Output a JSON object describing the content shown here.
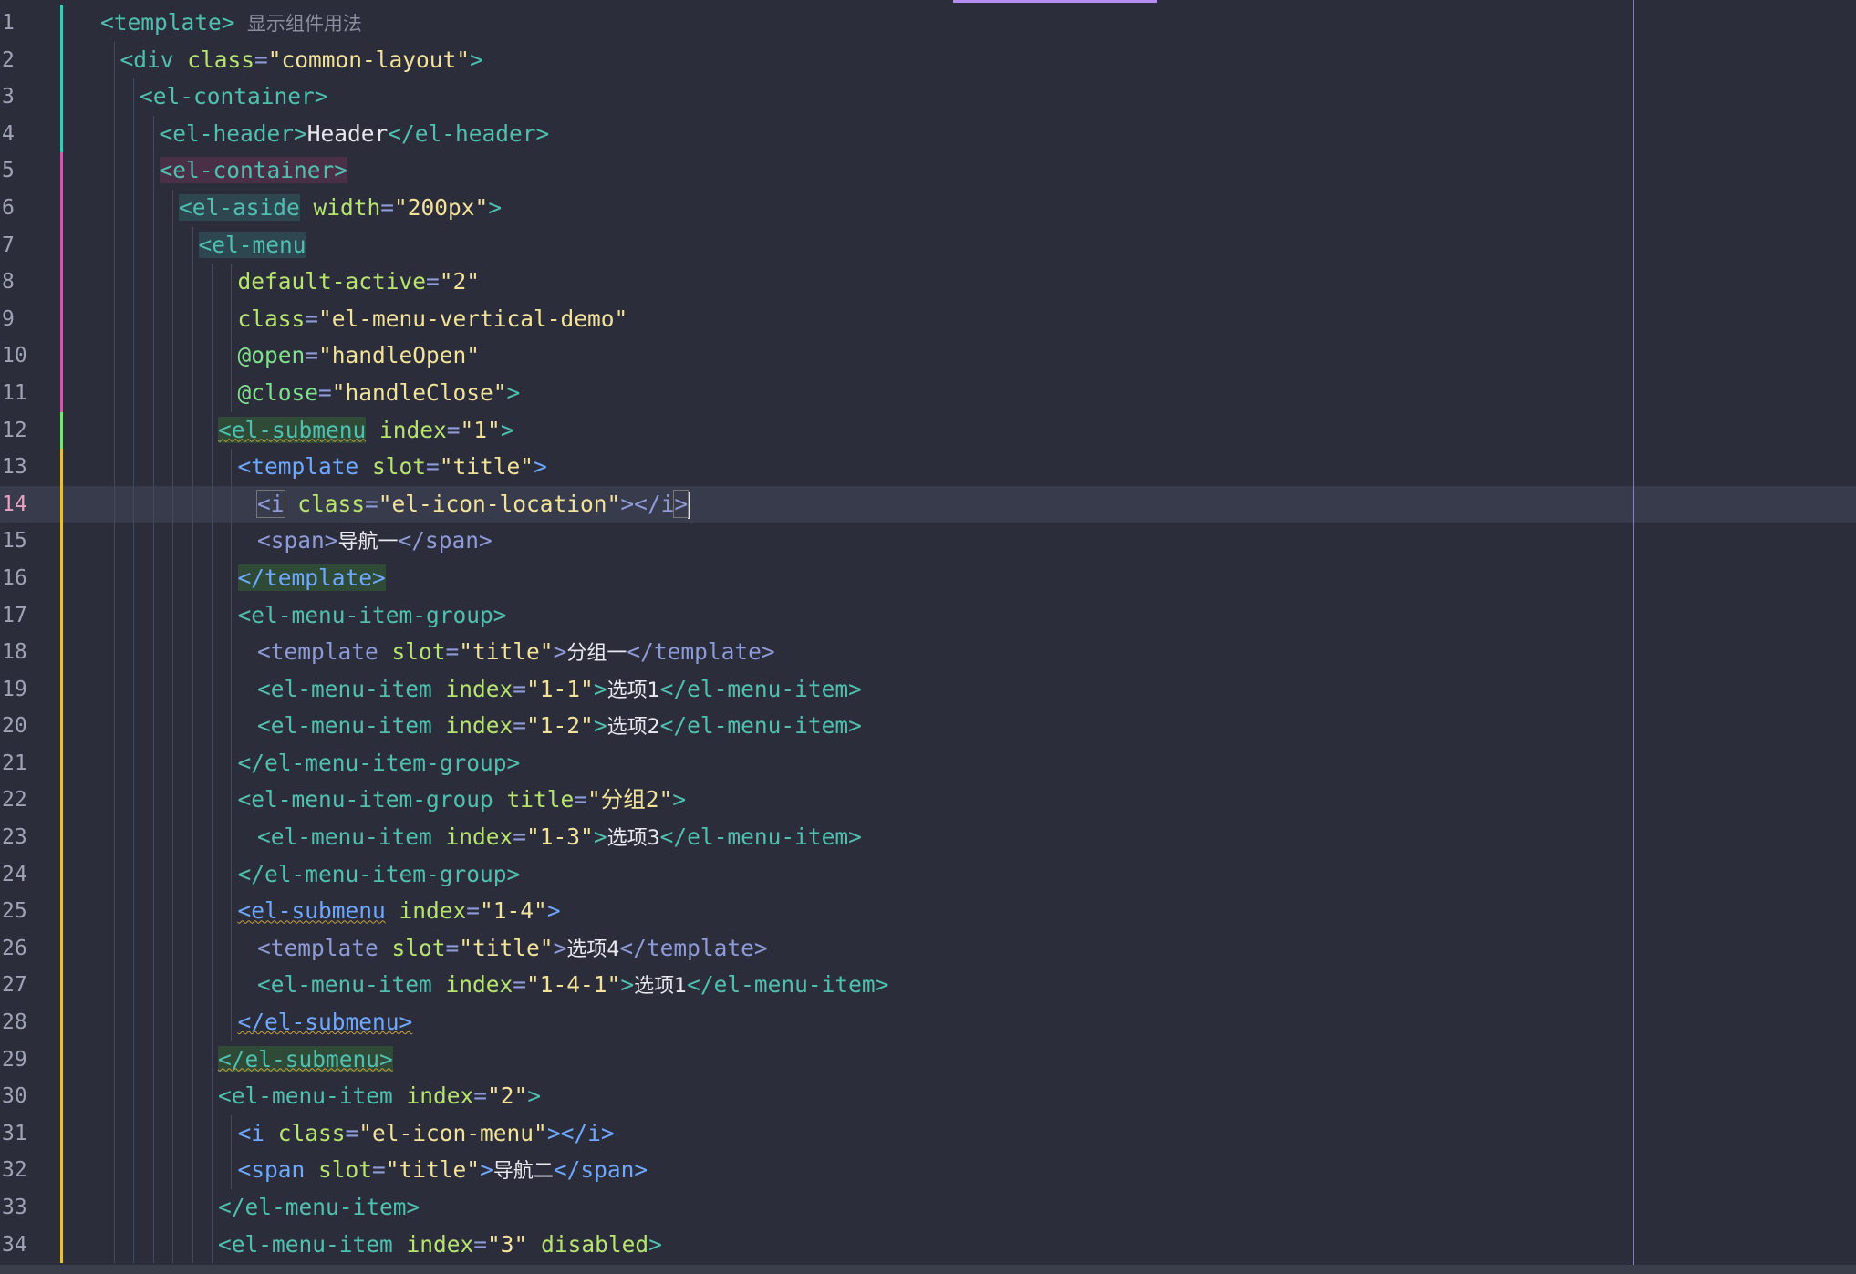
{
  "editor": {
    "current_line": 14,
    "colors": {
      "background": "#2b2d3a",
      "current_line": "#383b4c",
      "tag": "#4fc0b0",
      "attribute": "#b6e46e",
      "string": "#f2e29a",
      "modified_gutter": "#e3c13b"
    },
    "lines": [
      {
        "n": "1",
        "tokens": [
          [
            "t",
            "<template>"
          ],
          [
            "cm",
            "  显示组件用法"
          ]
        ]
      },
      {
        "n": "2",
        "tokens": [
          [
            "t",
            "<div "
          ],
          [
            "at",
            "class"
          ],
          [
            "pu",
            "="
          ],
          [
            "st",
            "\"common-layout\""
          ],
          [
            "t",
            ">"
          ]
        ]
      },
      {
        "n": "3",
        "tokens": [
          [
            "t",
            "<el-container>"
          ]
        ]
      },
      {
        "n": "4",
        "tokens": [
          [
            "t",
            "<el-header>"
          ],
          [
            "txt",
            "Header"
          ],
          [
            "t",
            "</el-header>"
          ]
        ]
      },
      {
        "n": "5",
        "tokens": [
          [
            "t hl-purple",
            "<el-container>"
          ]
        ]
      },
      {
        "n": "6",
        "tokens": [
          [
            "t hl-teal",
            "<el-aside"
          ],
          [
            "at",
            " width"
          ],
          [
            "pu",
            "="
          ],
          [
            "st",
            "\"200px\""
          ],
          [
            "t",
            ">"
          ]
        ]
      },
      {
        "n": "7",
        "tokens": [
          [
            "t hl-teal",
            "<el-menu"
          ]
        ]
      },
      {
        "n": "8",
        "tokens": [
          [
            "at",
            "default-active"
          ],
          [
            "pu",
            "="
          ],
          [
            "st",
            "\"2\""
          ]
        ]
      },
      {
        "n": "9",
        "tokens": [
          [
            "at",
            "class"
          ],
          [
            "pu",
            "="
          ],
          [
            "st",
            "\"el-menu-vertical-demo\""
          ]
        ]
      },
      {
        "n": "10",
        "tokens": [
          [
            "ev",
            "@open"
          ],
          [
            "pu",
            "="
          ],
          [
            "st",
            "\"handleOpen\""
          ]
        ]
      },
      {
        "n": "11",
        "tokens": [
          [
            "ev",
            "@close"
          ],
          [
            "pu",
            "="
          ],
          [
            "st",
            "\"handleClose\""
          ],
          [
            "t",
            ">"
          ]
        ]
      },
      {
        "n": "12",
        "tokens": [
          [
            "t hl-green wavy",
            "<el-submenu"
          ],
          [
            "at",
            " index"
          ],
          [
            "pu",
            "="
          ],
          [
            "st",
            "\"1\""
          ],
          [
            "t",
            ">"
          ]
        ]
      },
      {
        "n": "13",
        "tokens": [
          [
            "tb",
            "<template"
          ],
          [
            "at",
            " slot"
          ],
          [
            "pu",
            "="
          ],
          [
            "st",
            "\"title\""
          ],
          [
            "tb",
            ">"
          ]
        ]
      },
      {
        "n": "14",
        "tokens": [
          [
            "pu box",
            "<i"
          ],
          [
            "at",
            " class"
          ],
          [
            "pu",
            "="
          ],
          [
            "st",
            "\"el-icon-location\""
          ],
          [
            "pu",
            "></i"
          ],
          [
            "pu box",
            ">"
          ]
        ]
      },
      {
        "n": "15",
        "tokens": [
          [
            "pu",
            "<span>"
          ],
          [
            "zh",
            "导航一"
          ],
          [
            "pu",
            "</span>"
          ]
        ]
      },
      {
        "n": "16",
        "tokens": [
          [
            "tb hl-green",
            "</template>"
          ]
        ]
      },
      {
        "n": "17",
        "tokens": [
          [
            "t",
            "<el-menu-item-group>"
          ]
        ]
      },
      {
        "n": "18",
        "tokens": [
          [
            "pu",
            "<template "
          ],
          [
            "at",
            "slot"
          ],
          [
            "pu",
            "="
          ],
          [
            "st",
            "\"title\""
          ],
          [
            "pu",
            ">"
          ],
          [
            "zh",
            "分组一"
          ],
          [
            "pu",
            "</template>"
          ]
        ]
      },
      {
        "n": "19",
        "tokens": [
          [
            "t",
            "<el-menu-item "
          ],
          [
            "at",
            "index"
          ],
          [
            "pu",
            "="
          ],
          [
            "st",
            "\"1-1\""
          ],
          [
            "t",
            ">"
          ],
          [
            "zh",
            "选项1"
          ],
          [
            "t",
            "</el-menu-item>"
          ]
        ]
      },
      {
        "n": "20",
        "tokens": [
          [
            "t",
            "<el-menu-item "
          ],
          [
            "at",
            "index"
          ],
          [
            "pu",
            "="
          ],
          [
            "st",
            "\"1-2\""
          ],
          [
            "t",
            ">"
          ],
          [
            "zh",
            "选项2"
          ],
          [
            "t",
            "</el-menu-item>"
          ]
        ]
      },
      {
        "n": "21",
        "tokens": [
          [
            "t",
            "</el-menu-item-group>"
          ]
        ]
      },
      {
        "n": "22",
        "tokens": [
          [
            "t",
            "<el-menu-item-group "
          ],
          [
            "at",
            "title"
          ],
          [
            "pu",
            "="
          ],
          [
            "st",
            "\"分组2\""
          ],
          [
            "t",
            ">"
          ]
        ]
      },
      {
        "n": "23",
        "tokens": [
          [
            "t",
            "<el-menu-item "
          ],
          [
            "at",
            "index"
          ],
          [
            "pu",
            "="
          ],
          [
            "st",
            "\"1-3\""
          ],
          [
            "t",
            ">"
          ],
          [
            "zh",
            "选项3"
          ],
          [
            "t",
            "</el-menu-item>"
          ]
        ]
      },
      {
        "n": "24",
        "tokens": [
          [
            "t",
            "</el-menu-item-group>"
          ]
        ]
      },
      {
        "n": "25",
        "tokens": [
          [
            "tb wavy",
            "<el-submenu"
          ],
          [
            "at",
            " index"
          ],
          [
            "pu",
            "="
          ],
          [
            "st",
            "\"1-4\""
          ],
          [
            "tb",
            ">"
          ]
        ]
      },
      {
        "n": "26",
        "tokens": [
          [
            "pu",
            "<template "
          ],
          [
            "at",
            "slot"
          ],
          [
            "pu",
            "="
          ],
          [
            "st",
            "\"title\""
          ],
          [
            "pu",
            ">"
          ],
          [
            "zh",
            "选项4"
          ],
          [
            "pu",
            "</template>"
          ]
        ]
      },
      {
        "n": "27",
        "tokens": [
          [
            "t",
            "<el-menu-item "
          ],
          [
            "at",
            "index"
          ],
          [
            "pu",
            "="
          ],
          [
            "st",
            "\"1-4-1\""
          ],
          [
            "t",
            ">"
          ],
          [
            "zh",
            "选项1"
          ],
          [
            "t",
            "</el-menu-item>"
          ]
        ]
      },
      {
        "n": "28",
        "tokens": [
          [
            "tb wavy",
            "</el-submenu>"
          ]
        ]
      },
      {
        "n": "29",
        "tokens": [
          [
            "t hl-green wavy",
            "</el-submenu>"
          ]
        ]
      },
      {
        "n": "30",
        "tokens": [
          [
            "t",
            "<el-menu-item "
          ],
          [
            "at",
            "index"
          ],
          [
            "pu",
            "="
          ],
          [
            "st",
            "\"2\""
          ],
          [
            "t",
            ">"
          ]
        ]
      },
      {
        "n": "31",
        "tokens": [
          [
            "tb",
            "<i "
          ],
          [
            "at",
            "class"
          ],
          [
            "pu",
            "="
          ],
          [
            "st",
            "\"el-icon-menu\""
          ],
          [
            "tb",
            "></i>"
          ]
        ]
      },
      {
        "n": "32",
        "tokens": [
          [
            "tb",
            "<span "
          ],
          [
            "at",
            "slot"
          ],
          [
            "pu",
            "="
          ],
          [
            "st",
            "\"title\""
          ],
          [
            "tb",
            ">"
          ],
          [
            "zh",
            "导航二"
          ],
          [
            "tb",
            "</span>"
          ]
        ]
      },
      {
        "n": "33",
        "tokens": [
          [
            "t",
            "</el-menu-item>"
          ]
        ]
      },
      {
        "n": "34",
        "tokens": [
          [
            "t",
            "<el-menu-item "
          ],
          [
            "at",
            "index"
          ],
          [
            "pu",
            "="
          ],
          [
            "st",
            "\"3\""
          ],
          [
            "at",
            " disabled"
          ],
          [
            "t",
            ">"
          ]
        ]
      }
    ]
  }
}
